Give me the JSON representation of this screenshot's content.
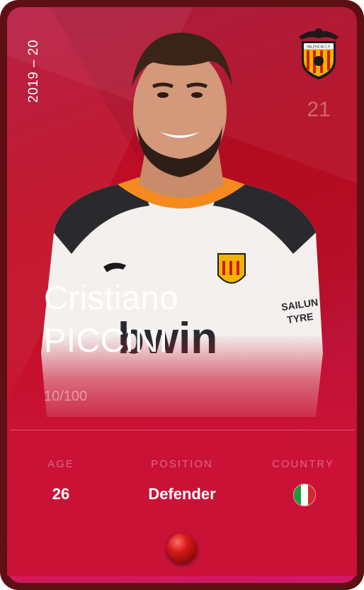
{
  "card": {
    "season": "2019 – 20",
    "jersey_number": "21",
    "club_crest_text": "VALENCIA C.F.",
    "first_name": "Cristiano",
    "last_name": "PICCINI",
    "serial": "10/100",
    "colors": {
      "frame": "#5e0f14",
      "background": "#c10c22",
      "accent": "#ff8a1a"
    }
  },
  "stats": {
    "age_label": "AGE",
    "age_value": "26",
    "position_label": "POSITION",
    "position_value": "Defender",
    "country_label": "COUNTRY",
    "country_flag": "italy-flag-icon"
  },
  "shirt": {
    "sponsor": "bwin",
    "sleeve_sponsor": "SAILUN TYRE"
  }
}
